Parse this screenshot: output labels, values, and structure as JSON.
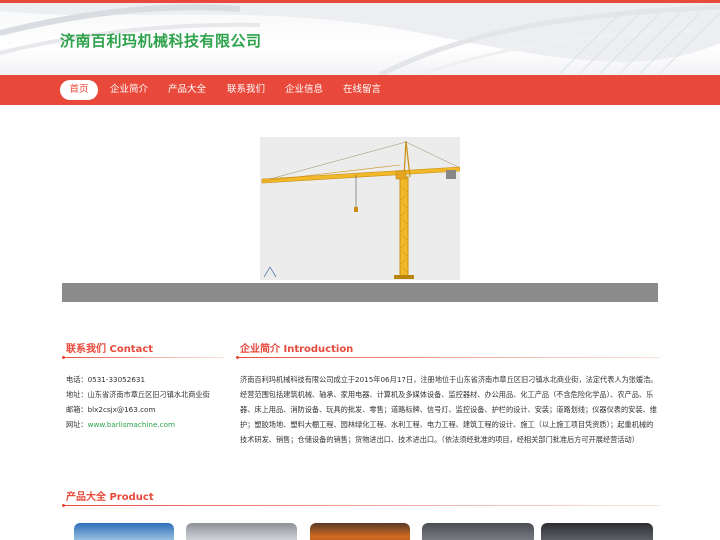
{
  "site": {
    "title": "济南百利玛机械科技有限公司"
  },
  "nav": {
    "items": [
      "首页",
      "企业简介",
      "产品大全",
      "联系我们",
      "企业信息",
      "在线留言"
    ]
  },
  "contact": {
    "title": "联系我们 Contact",
    "phone_label": "电话：",
    "phone": "0531-33052631",
    "address_label": "地址：",
    "address": "山东省济南市章丘区旧刁镇水北商业街",
    "email_label": "邮箱：",
    "email": "blx2csjx@163.com",
    "website_label": "网址：",
    "website": "www.barlismachine.com"
  },
  "intro": {
    "title": "企业简介 Introduction",
    "text": "济南百利玛机械科技有限公司成立于2015年06月17日，注册地位于山东省济南市章丘区旧刁镇水北商业街，法定代表人为张媛浩。经营范围包括建筑机械、轴承、家用电器、计算机及多媒体设备、监控器材、办公用品、化工产品（不含危险化学品）、农产品、乐器、床上用品、消防设备、玩具的批发、零售；道路标牌、信号灯、监控设备、护栏的设计、安装；道路划线；仪器仪表的安装、维护；塑胶场地、塑料大棚工程、园林绿化工程、水利工程、电力工程、建筑工程的设计、施工（以上施工项目凭资质）；起重机械的技术研发、销售；仓储设备的销售；货物进出口、技术进出口。（依法须经批准的项目，经相关部门批准后方可开展经营活动）"
  },
  "products": {
    "title": "产品大全 Product"
  },
  "colors": {
    "accent": "#e8493b",
    "brand_green": "#2ea24b"
  }
}
